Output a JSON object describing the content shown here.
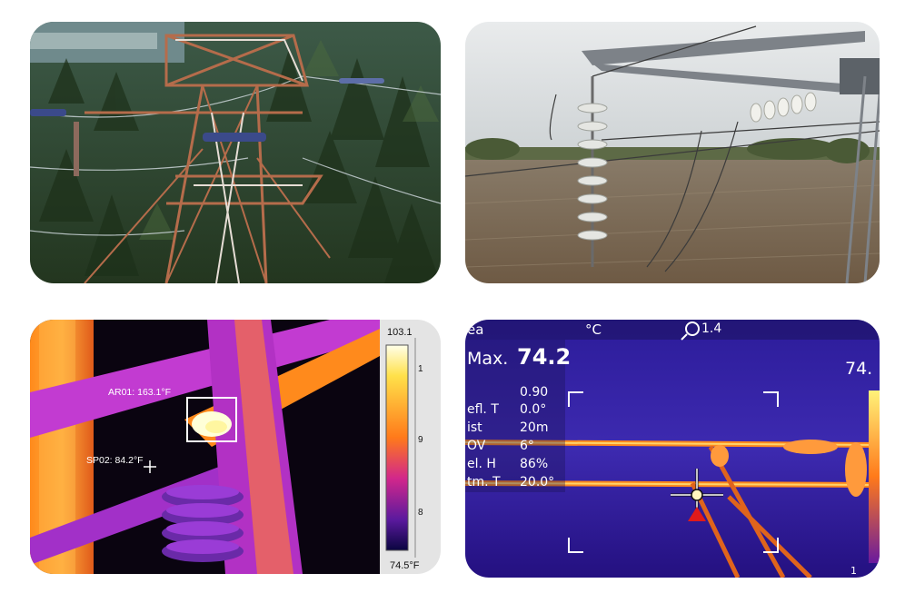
{
  "tiles": {
    "top_left": {
      "icon": "transmission-tower-photo"
    },
    "top_right": {
      "icon": "insulator-string-photo"
    },
    "bottom_left": {
      "label_ar01": "AR01: 163.1°F",
      "label_sp02": "SP02: 84.2°F",
      "scale_max": "103.1",
      "scale_min": "74.5°F",
      "scale_ticks": [
        "1",
        "9",
        "8"
      ]
    },
    "bottom_right": {
      "header_left": "ea",
      "header_unit": "°C",
      "header_zoom": "1.4",
      "max_label": "Max.",
      "max_value": "74.2",
      "right_value": "74.",
      "bottom_right_value": "1",
      "params": [
        {
          "label": "",
          "value": "0.90"
        },
        {
          "label": "efl. T",
          "value": "0.0°"
        },
        {
          "label": "ist",
          "value": "20m"
        },
        {
          "label": "OV",
          "value": "6°"
        },
        {
          "label": "el. H",
          "value": "86%"
        },
        {
          "label": "tm. T",
          "value": "20.0°"
        }
      ]
    }
  },
  "colors": {
    "thermal_hot": "#fff27a",
    "thermal_warm": "#ff8a1c",
    "thermal_mid": "#c23bd1",
    "thermal_cool": "#2a1a8a",
    "forest": "#2f4a2a",
    "sky": "#d9dde0",
    "field": "#7d6a55"
  }
}
